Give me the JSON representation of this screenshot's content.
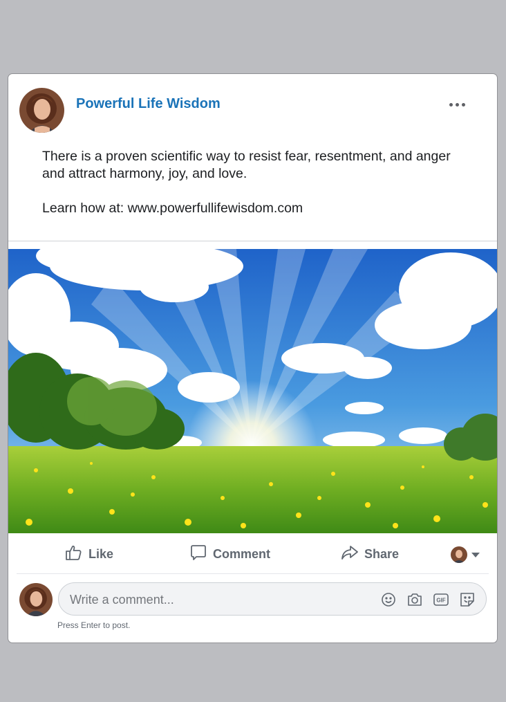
{
  "post": {
    "page_name": "Powerful Life Wisdom",
    "text_line1": "There is a proven scientific way to resist fear, resentment, and anger and attract harmony, joy, and love.",
    "text_line2": "Learn how at: www.powerfullifewisdom.com"
  },
  "actions": {
    "like_label": "Like",
    "comment_label": "Comment",
    "share_label": "Share"
  },
  "comment": {
    "placeholder": "Write a comment...",
    "hint": "Press Enter to post."
  },
  "icons": {
    "more": "more-options-icon",
    "like": "thumbs-up-icon",
    "comment": "speech-bubble-icon",
    "share": "share-arrow-icon",
    "emoji": "smiley-icon",
    "camera": "camera-icon",
    "gif": "gif-icon",
    "sticker": "sticker-icon"
  },
  "colors": {
    "page_name": "#1a73b8",
    "action_text": "#606770",
    "background": "#bcbdc1"
  }
}
